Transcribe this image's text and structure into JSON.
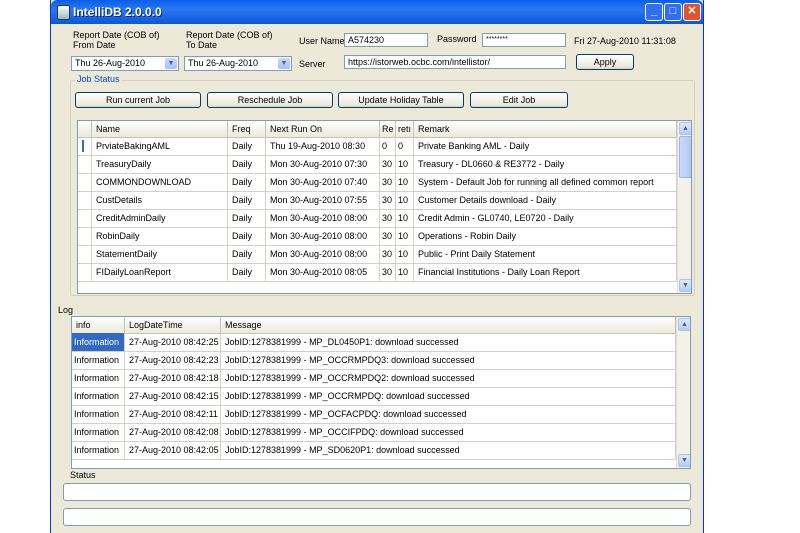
{
  "window": {
    "title": "IntelliDB 2.0.0.0",
    "icon": "app-icon"
  },
  "header": {
    "from_date_label_1": "Report Date (COB of)",
    "from_date_label_2": "From Date",
    "to_date_label_1": "Report Date (COB of)",
    "to_date_label_2": "To Date",
    "from_date_value": "Thu 26-Aug-2010",
    "to_date_value": "Thu 26-Aug-2010",
    "username_label": "User Name",
    "username_value": "A574230",
    "password_label": "Password",
    "password_value": "********",
    "server_label": "Server",
    "server_value": "https://istorweb.ocbc.com/intellistor/",
    "datetime": "Fri 27-Aug-2010 11:31:08",
    "apply_label": "Apply"
  },
  "job_status": {
    "legend": "Job Status",
    "buttons": [
      "Run current Job",
      "Reschedule Job",
      "Update Holiday Table",
      "Edit Job"
    ],
    "columns": [
      "Name",
      "Freq",
      "Next Run On",
      "Re",
      "retı",
      "Remark"
    ],
    "rows": [
      [
        "PrviateBakingAML",
        "Daily",
        "Thu 19-Aug-2010 08:30",
        "0",
        "0",
        "Private Banking AML - Daily"
      ],
      [
        "TreasuryDaily",
        "Daily",
        "Mon 30-Aug-2010 07:30",
        "30",
        "10",
        "Treasury - DL0660 & RE3772 - Daily"
      ],
      [
        "COMMONDOWNLOAD",
        "Daily",
        "Mon 30-Aug-2010 07:40",
        "30",
        "10",
        "System - Default Job for running all defined common report"
      ],
      [
        "CustDetails",
        "Daily",
        "Mon 30-Aug-2010 07:55",
        "30",
        "10",
        "Customer Details download - Daily"
      ],
      [
        "CreditAdminDaily",
        "Daily",
        "Mon 30-Aug-2010 08:00",
        "30",
        "10",
        "Credit Admin - GL0740, LE0720 - Daily"
      ],
      [
        "RobinDaily",
        "Daily",
        "Mon 30-Aug-2010 08:00",
        "30",
        "10",
        "Operations - Robin Daily"
      ],
      [
        "StatementDaily",
        "Daily",
        "Mon 30-Aug-2010 08:00",
        "30",
        "10",
        "Public - Print Daily Statement"
      ],
      [
        "FIDailyLoanReport",
        "Daily",
        "Mon 30-Aug-2010 08:05",
        "30",
        "10",
        "Financial Institutions - Daily Loan Report"
      ]
    ]
  },
  "log": {
    "label": "Log",
    "columns": [
      "info",
      "LogDateTime",
      "Message"
    ],
    "rows": [
      [
        "Information",
        "27-Aug-2010 08:42:25",
        "JobID:1278381999 - MP_DL0450P1: download successed"
      ],
      [
        "Information",
        "27-Aug-2010 08:42:23",
        "JobID:1278381999 - MP_OCCRMPDQ3: download successed"
      ],
      [
        "Information",
        "27-Aug-2010 08:42:18",
        "JobID:1278381999 - MP_OCCRMPDQ2: download successed"
      ],
      [
        "Information",
        "27-Aug-2010 08:42:15",
        "JobID:1278381999 - MP_OCCRMPDQ: download successed"
      ],
      [
        "Information",
        "27-Aug-2010 08:42:11",
        "JobID:1278381999 - MP_OCFACPDQ: download successed"
      ],
      [
        "Information",
        "27-Aug-2010 08:42:08",
        "JobID:1278381999 - MP_OCCIFPDQ: download successed"
      ],
      [
        "Information",
        "27-Aug-2010 08:42:05",
        "JobID:1278381999 - MP_SD0620P1: download successed"
      ]
    ]
  },
  "status": {
    "label": "Status"
  },
  "colors": {
    "titlebar": "#0a5ee8",
    "selection": "#316ac5",
    "window_bg": "#ece9d8",
    "legend_text": "#0046d5"
  }
}
